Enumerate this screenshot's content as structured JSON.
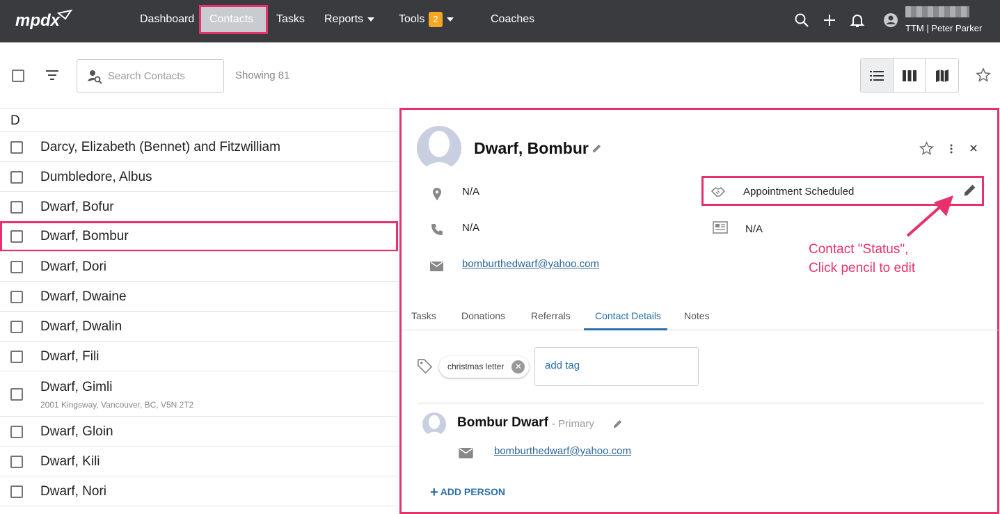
{
  "brand": {
    "logo_text": "mpdx",
    "accent": "#e8316b",
    "link_color": "#2a6fa6",
    "topbar_bg": "#3a3b3f"
  },
  "nav": {
    "dashboard": "Dashboard",
    "contacts": "Contacts",
    "tasks": "Tasks",
    "reports": "Reports",
    "tools": "Tools",
    "tools_badge": "2",
    "coaches": "Coaches"
  },
  "user": {
    "account": "TTM | Peter Parker"
  },
  "toolbar": {
    "search_placeholder": "Search Contacts",
    "showing": "Showing 81"
  },
  "list": {
    "group_letter": "D",
    "contacts": [
      {
        "name": "Darcy, Elizabeth (Bennet) and Fitzwilliam",
        "address": ""
      },
      {
        "name": "Dumbledore, Albus",
        "address": ""
      },
      {
        "name": "Dwarf, Bofur",
        "address": ""
      },
      {
        "name": "Dwarf, Bombur",
        "address": ""
      },
      {
        "name": "Dwarf, Dori",
        "address": ""
      },
      {
        "name": "Dwarf, Dwaine",
        "address": ""
      },
      {
        "name": "Dwarf, Dwalin",
        "address": ""
      },
      {
        "name": "Dwarf, Fili",
        "address": ""
      },
      {
        "name": "Dwarf, Gimli",
        "address": "2001 Kingsway, Vancouver, BC, V5N 2T2"
      },
      {
        "name": "Dwarf, Gloin",
        "address": ""
      },
      {
        "name": "Dwarf, Kili",
        "address": ""
      },
      {
        "name": "Dwarf, Nori",
        "address": ""
      }
    ]
  },
  "detail": {
    "name": "Dwarf, Bombur",
    "address": "N/A",
    "phone": "N/A",
    "email": "bomburthedwarf@yahoo.com",
    "status": "Appointment Scheduled",
    "newsletter": "N/A",
    "annotation_line1": "Contact \"Status\",",
    "annotation_line2": "Click pencil to edit",
    "tabs": [
      "Tasks",
      "Donations",
      "Referrals",
      "Contact Details",
      "Notes"
    ],
    "tag": "christmas letter",
    "tag_placeholder": "add tag",
    "person_name": "Bombur Dwarf",
    "person_role": "- Primary",
    "person_email": "bomburthedwarf@yahoo.com",
    "add_person": "ADD PERSON"
  }
}
